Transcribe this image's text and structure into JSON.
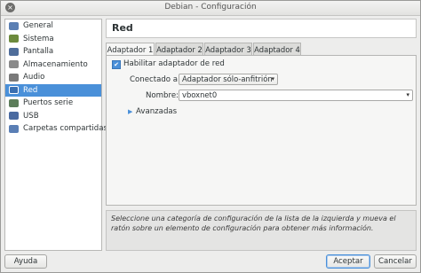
{
  "window": {
    "title": "Debian - Configuración",
    "close_glyph": "×"
  },
  "sidebar": {
    "items": [
      {
        "label": "General",
        "icon": "general-icon",
        "color": "#5b7fb3"
      },
      {
        "label": "Sistema",
        "icon": "system-icon",
        "color": "#6c8a3c"
      },
      {
        "label": "Pantalla",
        "icon": "display-icon",
        "color": "#4f6d9a"
      },
      {
        "label": "Almacenamiento",
        "icon": "storage-icon",
        "color": "#8a8a8a"
      },
      {
        "label": "Audio",
        "icon": "audio-icon",
        "color": "#7a7a7a"
      },
      {
        "label": "Red",
        "icon": "network-icon",
        "color": "#3a6fb0",
        "selected": true
      },
      {
        "label": "Puertos serie",
        "icon": "serial-ports-icon",
        "color": "#5c7d5a"
      },
      {
        "label": "USB",
        "icon": "usb-icon",
        "color": "#4a6aa0"
      },
      {
        "label": "Carpetas compartidas",
        "icon": "shared-folders-icon",
        "color": "#5a7fb5"
      }
    ]
  },
  "header": {
    "title": "Red"
  },
  "tabs": [
    {
      "label": "Adaptador 1",
      "active": true
    },
    {
      "label": "Adaptador 2"
    },
    {
      "label": "Adaptador 3"
    },
    {
      "label": "Adaptador 4"
    }
  ],
  "adapter": {
    "enable_label": "Habilitar adaptador de red",
    "enable_checked": true,
    "check_glyph": "✔",
    "attached_label": "Conectado a:",
    "attached_value": "Adaptador sólo-anfitrión",
    "name_label": "Nombre:",
    "name_value": "vboxnet0",
    "advanced_label": "Avanzadas",
    "disclosure_glyph": "▶",
    "combo_arrow_glyph": "▾"
  },
  "info": {
    "text": "Seleccione una categoría de configuración de la lista de la izquierda y mueva el ratón sobre un elemento de configuración para obtener más información."
  },
  "buttons": {
    "help": "Ayuda",
    "accept": "Aceptar",
    "cancel": "Cancelar"
  },
  "colors": {
    "accent": "#4a90d9"
  }
}
